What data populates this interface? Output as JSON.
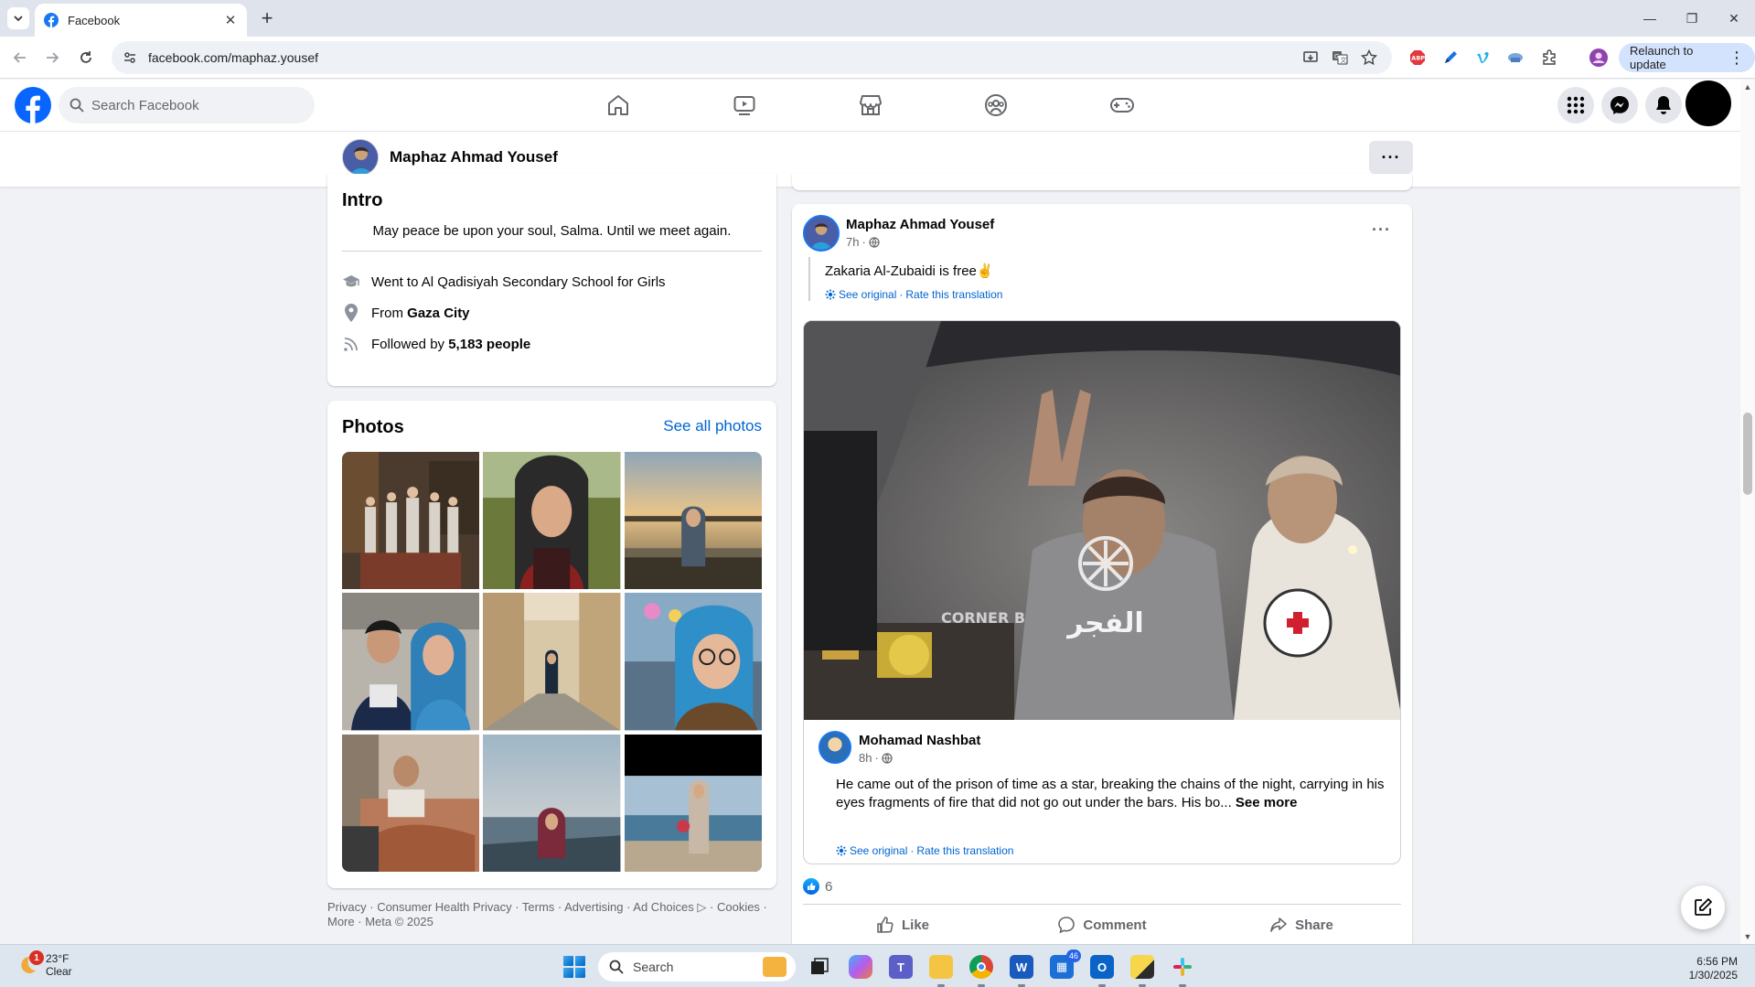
{
  "browser": {
    "tab_title": "Facebook",
    "url": "facebook.com/maphaz.yousef",
    "relaunch_label": "Relaunch to update"
  },
  "fb": {
    "search_placeholder": "Search Facebook"
  },
  "profile": {
    "name": "Maphaz Ahmad Yousef"
  },
  "intro": {
    "title": "Intro",
    "bio": "May peace be upon your soul, Salma. Until we meet again.",
    "education": "Went to Al Qadisiyah Secondary School for Girls",
    "from_prefix": "From",
    "from_place": "Gaza City",
    "followers_prefix": "Followed by",
    "followers_count": "5,183 people"
  },
  "photos": {
    "title": "Photos",
    "see_all": "See all photos"
  },
  "footer": {
    "links": [
      "Privacy",
      "Consumer Health Privacy",
      "Terms",
      "Advertising",
      "Ad Choices",
      "Cookies",
      "More",
      "Meta © 2025"
    ]
  },
  "post": {
    "author": "Maphaz Ahmad Yousef",
    "time": "7h",
    "text": "Zakaria Al-Zubaidi is free✌️",
    "see_original": "See original",
    "rate_translation": "Rate this translation",
    "reaction_count": "6",
    "actions": {
      "like": "Like",
      "comment": "Comment",
      "share": "Share"
    },
    "shared": {
      "image_watermark": "الفجر",
      "author": "Mohamad Nashbat",
      "time": "8h",
      "text": "He came out of the prison of time as a star, breaking the chains of the night, carrying in his eyes fragments of fire that did not go out under the bars. His bo...",
      "see_more": "See more",
      "see_original": "See original",
      "rate_translation": "Rate this translation"
    }
  },
  "taskbar": {
    "temperature": "23°F",
    "condition": "Clear",
    "weather_badge": "1",
    "search_label": "Search",
    "teams_badge": "46",
    "time": "6:56 PM",
    "date": "1/30/2025"
  },
  "colors": {
    "fb_blue": "#1877f2",
    "link_blue": "#0064d1",
    "page_bg": "#f0f2f5"
  }
}
